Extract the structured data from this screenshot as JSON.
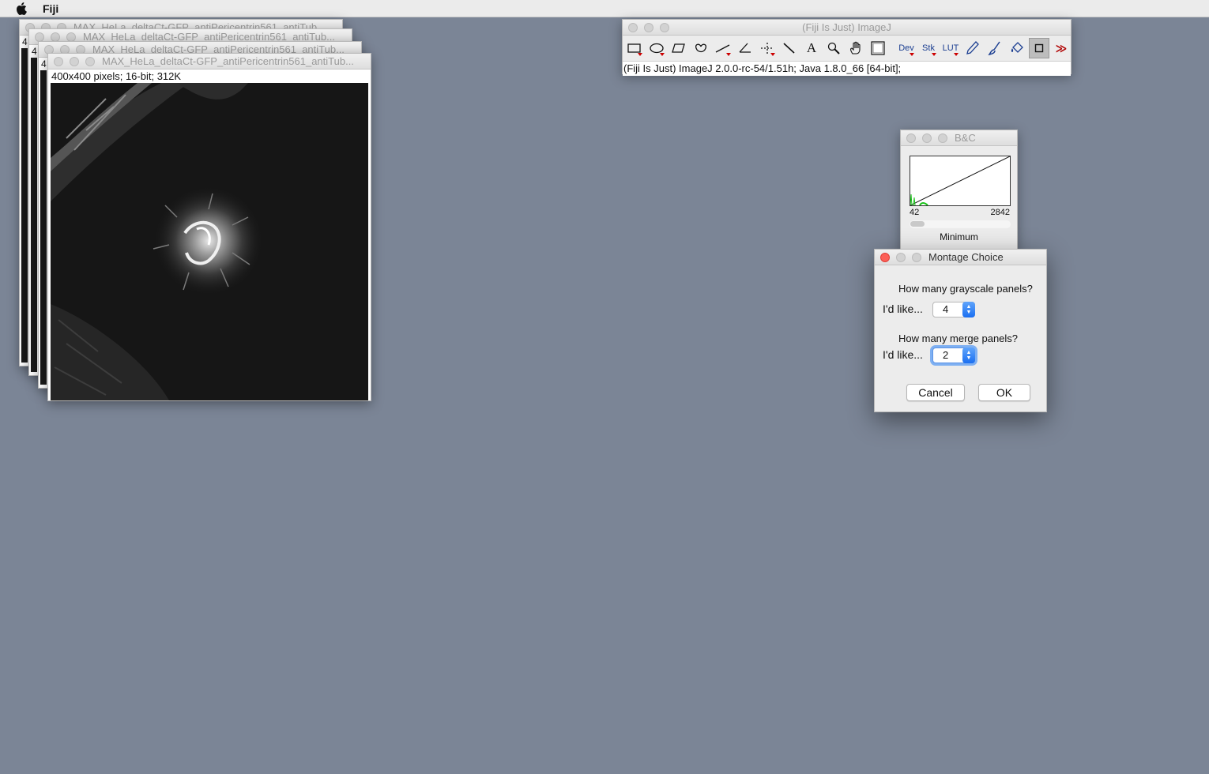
{
  "menubar": {
    "app_name": "Fiji"
  },
  "image_windows": {
    "back_titles": [
      "MAX_HeLa_deltaCt-GFP_antiPericentrin561_antiTub...",
      "MAX_HeLa_deltaCt-GFP_antiPericentrin561_antiTub...",
      "MAX_HeLa_deltaCt-GFP_antiPericentrin561_antiTub..."
    ],
    "back_indicator": "4",
    "front_title": "MAX_HeLa_deltaCt-GFP_antiPericentrin561_antiTub...",
    "front_info": "400x400 pixels; 16-bit; 312K"
  },
  "imagej": {
    "title": "(Fiji Is Just) ImageJ",
    "status": "(Fiji Is Just) ImageJ 2.0.0-rc-54/1.51h; Java 1.8.0_66 [64-bit];",
    "tools": [
      {
        "icon": "rectangle-select-icon",
        "label": ""
      },
      {
        "icon": "oval-select-icon",
        "label": ""
      },
      {
        "icon": "polygon-select-icon",
        "label": ""
      },
      {
        "icon": "freehand-select-icon",
        "label": ""
      },
      {
        "icon": "line-tool-icon",
        "label": ""
      },
      {
        "icon": "angle-tool-icon",
        "label": ""
      },
      {
        "icon": "point-tool-icon",
        "label": ""
      },
      {
        "icon": "wand-tool-icon",
        "label": ""
      },
      {
        "icon": "text-tool-icon",
        "label": "A"
      },
      {
        "icon": "magnifier-icon",
        "label": ""
      },
      {
        "icon": "hand-tool-icon",
        "label": ""
      },
      {
        "icon": "color-picker-icon",
        "label": ""
      },
      {
        "icon": "dev-menu-icon",
        "label": "Dev"
      },
      {
        "icon": "stk-menu-icon",
        "label": "Stk"
      },
      {
        "icon": "lut-menu-icon",
        "label": "LUT"
      },
      {
        "icon": "pencil-icon",
        "label": ""
      },
      {
        "icon": "brush-icon",
        "label": ""
      },
      {
        "icon": "flood-fill-icon",
        "label": ""
      },
      {
        "icon": "square-tool-icon",
        "label": ""
      },
      {
        "icon": "more-tools-icon",
        "label": "≫"
      }
    ]
  },
  "bc": {
    "title": "B&C",
    "min_value": "42",
    "max_value": "2842",
    "slider_label": "Minimum",
    "slider_fraction": 0.0
  },
  "dialog": {
    "title": "Montage Choice",
    "q1": "How many grayscale panels?",
    "label1": "I'd like...",
    "value1": "4",
    "q2": "How many merge panels?",
    "label2": "I'd like...",
    "value2": "2",
    "cancel": "Cancel",
    "ok": "OK"
  },
  "colors": {
    "desktop": "#7b8596",
    "close_red": "#fc5f57",
    "focus_blue": "#5b93e6"
  }
}
